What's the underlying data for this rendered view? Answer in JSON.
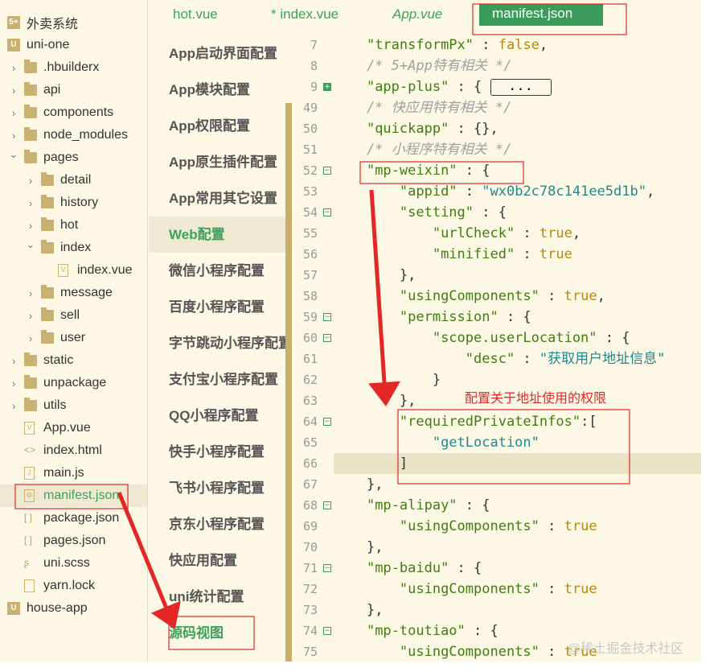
{
  "sidebar": {
    "items": [
      {
        "label": "外卖系统",
        "icon": "hbuilder-project-icon",
        "level": 0,
        "kind": "project5"
      },
      {
        "label": "uni-one",
        "icon": "uni-project-icon",
        "level": 0,
        "kind": "project"
      },
      {
        "label": ".hbuilderx",
        "icon": "folder-icon",
        "level": 1,
        "kind": "folder",
        "state": "collapsed"
      },
      {
        "label": "api",
        "icon": "folder-icon",
        "level": 1,
        "kind": "folder",
        "state": "collapsed"
      },
      {
        "label": "components",
        "icon": "folder-icon",
        "level": 1,
        "kind": "folder",
        "state": "collapsed"
      },
      {
        "label": "node_modules",
        "icon": "folder-icon",
        "level": 1,
        "kind": "folder",
        "state": "collapsed"
      },
      {
        "label": "pages",
        "icon": "folder-open-icon",
        "level": 1,
        "kind": "folder",
        "state": "expanded"
      },
      {
        "label": "detail",
        "icon": "folder-icon",
        "level": 2,
        "kind": "folder",
        "state": "collapsed"
      },
      {
        "label": "history",
        "icon": "folder-icon",
        "level": 2,
        "kind": "folder",
        "state": "collapsed"
      },
      {
        "label": "hot",
        "icon": "folder-icon",
        "level": 2,
        "kind": "folder",
        "state": "collapsed"
      },
      {
        "label": "index",
        "icon": "folder-open-icon",
        "level": 2,
        "kind": "folder",
        "state": "expanded"
      },
      {
        "label": "index.vue",
        "icon": "vue-file-icon",
        "level": 3,
        "kind": "file",
        "glyph": "V"
      },
      {
        "label": "message",
        "icon": "folder-icon",
        "level": 2,
        "kind": "folder",
        "state": "collapsed"
      },
      {
        "label": "sell",
        "icon": "folder-icon",
        "level": 2,
        "kind": "folder",
        "state": "collapsed"
      },
      {
        "label": "user",
        "icon": "folder-icon",
        "level": 2,
        "kind": "folder",
        "state": "collapsed"
      },
      {
        "label": "static",
        "icon": "folder-icon",
        "level": 1,
        "kind": "folder",
        "state": "collapsed"
      },
      {
        "label": "unpackage",
        "icon": "folder-icon",
        "level": 1,
        "kind": "folder",
        "state": "collapsed"
      },
      {
        "label": "utils",
        "icon": "folder-icon",
        "level": 1,
        "kind": "folder",
        "state": "collapsed"
      },
      {
        "label": "App.vue",
        "icon": "vue-file-icon",
        "level": 1,
        "kind": "file",
        "glyph": "V"
      },
      {
        "label": "index.html",
        "icon": "html-file-icon",
        "level": 1,
        "kind": "text",
        "glyph": "<>"
      },
      {
        "label": "main.js",
        "icon": "js-file-icon",
        "level": 1,
        "kind": "file",
        "glyph": "J"
      },
      {
        "label": "manifest.json",
        "icon": "manifest-file-icon",
        "level": 1,
        "kind": "file",
        "glyph": "⚙",
        "selected": true
      },
      {
        "label": "package.json",
        "icon": "json-file-icon",
        "level": 1,
        "kind": "text",
        "glyph": "[ ]"
      },
      {
        "label": "pages.json",
        "icon": "json-file-icon",
        "level": 1,
        "kind": "text",
        "glyph": "[ ]"
      },
      {
        "label": "uni.scss",
        "icon": "scss-file-icon",
        "level": 1,
        "kind": "text",
        "glyph": "ʂ"
      },
      {
        "label": "yarn.lock",
        "icon": "file-icon",
        "level": 1,
        "kind": "file",
        "glyph": ""
      },
      {
        "label": "house-app",
        "icon": "uni-project-icon",
        "level": 0,
        "kind": "project"
      }
    ]
  },
  "tabs": [
    {
      "label": "hot.vue"
    },
    {
      "label": "* index.vue"
    },
    {
      "label": "App.vue",
      "italic": true
    },
    {
      "label": "manifest.json",
      "active": true
    }
  ],
  "settings": {
    "items": [
      {
        "label": "App启动界面配置"
      },
      {
        "label": "App模块配置"
      },
      {
        "label": "App权限配置"
      },
      {
        "label": "App原生插件配置"
      },
      {
        "label": "App常用其它设置"
      },
      {
        "label": "Web配置",
        "selected": true
      },
      {
        "label": "微信小程序配置"
      },
      {
        "label": "百度小程序配置"
      },
      {
        "label": "字节跳动小程序配置"
      },
      {
        "label": "支付宝小程序配置"
      },
      {
        "label": "QQ小程序配置"
      },
      {
        "label": "快手小程序配置"
      },
      {
        "label": "飞书小程序配置"
      },
      {
        "label": "京东小程序配置"
      },
      {
        "label": "快应用配置"
      },
      {
        "label": "uni统计配置"
      },
      {
        "label": "源码视图",
        "highlight": true
      }
    ]
  },
  "editor": {
    "lines": [
      {
        "n": "7",
        "i": 1,
        "t": [
          [
            "k",
            "\"transformPx\""
          ],
          [
            "p",
            " : "
          ],
          [
            "b",
            "false"
          ],
          [
            "p",
            ","
          ]
        ]
      },
      {
        "n": "8",
        "i": 1,
        "t": [
          [
            "c",
            "/* 5+App特有相关 */"
          ]
        ]
      },
      {
        "n": "9",
        "i": 1,
        "fold": "plus",
        "t": [
          [
            "k",
            "\"app-plus\""
          ],
          [
            "p",
            " : { "
          ],
          [
            "coll",
            "..."
          ]
        ]
      },
      {
        "n": "49",
        "i": 1,
        "t": [
          [
            "c",
            "/* 快应用特有相关 */"
          ]
        ]
      },
      {
        "n": "50",
        "i": 1,
        "t": [
          [
            "k",
            "\"quickapp\""
          ],
          [
            "p",
            " : {},"
          ]
        ]
      },
      {
        "n": "51",
        "i": 1,
        "t": [
          [
            "c",
            "/* 小程序特有相关 */"
          ]
        ]
      },
      {
        "n": "52",
        "i": 1,
        "fold": "minus",
        "t": [
          [
            "k",
            "\"mp-weixin\""
          ],
          [
            "p",
            " : {"
          ]
        ]
      },
      {
        "n": "53",
        "i": 2,
        "t": [
          [
            "k",
            "\"appid\""
          ],
          [
            "p",
            " : "
          ],
          [
            "s",
            "\"wx0b2c78c141ee5d1b\""
          ],
          [
            "p",
            ","
          ]
        ]
      },
      {
        "n": "54",
        "i": 2,
        "fold": "minus",
        "t": [
          [
            "k",
            "\"setting\""
          ],
          [
            "p",
            " : {"
          ]
        ]
      },
      {
        "n": "55",
        "i": 3,
        "t": [
          [
            "k",
            "\"urlCheck\""
          ],
          [
            "p",
            " : "
          ],
          [
            "b",
            "true"
          ],
          [
            "p",
            ","
          ]
        ]
      },
      {
        "n": "56",
        "i": 3,
        "t": [
          [
            "k",
            "\"minified\""
          ],
          [
            "p",
            " : "
          ],
          [
            "b",
            "true"
          ]
        ]
      },
      {
        "n": "57",
        "i": 2,
        "t": [
          [
            "p",
            "},"
          ]
        ]
      },
      {
        "n": "58",
        "i": 2,
        "t": [
          [
            "k",
            "\"usingComponents\""
          ],
          [
            "p",
            " : "
          ],
          [
            "b",
            "true"
          ],
          [
            "p",
            ","
          ]
        ]
      },
      {
        "n": "59",
        "i": 2,
        "fold": "minus",
        "t": [
          [
            "k",
            "\"permission\""
          ],
          [
            "p",
            " : {"
          ]
        ]
      },
      {
        "n": "60",
        "i": 3,
        "fold": "minus",
        "t": [
          [
            "k",
            "\"scope.userLocation\""
          ],
          [
            "p",
            " : {"
          ]
        ]
      },
      {
        "n": "61",
        "i": 4,
        "t": [
          [
            "k",
            "\"desc\""
          ],
          [
            "p",
            " : "
          ],
          [
            "s",
            "\"获取用户地址信息\""
          ]
        ]
      },
      {
        "n": "62",
        "i": 3,
        "t": [
          [
            "p",
            "}"
          ]
        ]
      },
      {
        "n": "63",
        "i": 2,
        "t": [
          [
            "p",
            "},"
          ]
        ]
      },
      {
        "n": "64",
        "i": 2,
        "fold": "minus",
        "t": [
          [
            "k",
            "\"requiredPrivateInfos\""
          ],
          [
            "p",
            ":["
          ]
        ]
      },
      {
        "n": "65",
        "i": 3,
        "t": [
          [
            "s",
            "\"getLocation\""
          ]
        ]
      },
      {
        "n": "66",
        "i": 2,
        "current": true,
        "t": [
          [
            "p",
            "]"
          ]
        ]
      },
      {
        "n": "67",
        "i": 1,
        "t": [
          [
            "p",
            "},"
          ]
        ]
      },
      {
        "n": "68",
        "i": 1,
        "fold": "minus",
        "t": [
          [
            "k",
            "\"mp-alipay\""
          ],
          [
            "p",
            " : {"
          ]
        ]
      },
      {
        "n": "69",
        "i": 2,
        "t": [
          [
            "k",
            "\"usingComponents\""
          ],
          [
            "p",
            " : "
          ],
          [
            "b",
            "true"
          ]
        ]
      },
      {
        "n": "70",
        "i": 1,
        "t": [
          [
            "p",
            "},"
          ]
        ]
      },
      {
        "n": "71",
        "i": 1,
        "fold": "minus",
        "t": [
          [
            "k",
            "\"mp-baidu\""
          ],
          [
            "p",
            " : {"
          ]
        ]
      },
      {
        "n": "72",
        "i": 2,
        "t": [
          [
            "k",
            "\"usingComponents\""
          ],
          [
            "p",
            " : "
          ],
          [
            "b",
            "true"
          ]
        ]
      },
      {
        "n": "73",
        "i": 1,
        "t": [
          [
            "p",
            "},"
          ]
        ]
      },
      {
        "n": "74",
        "i": 1,
        "fold": "minus",
        "t": [
          [
            "k",
            "\"mp-toutiao\""
          ],
          [
            "p",
            " : {"
          ]
        ]
      },
      {
        "n": "75",
        "i": 2,
        "t": [
          [
            "k",
            "\"usingComponents\""
          ],
          [
            "p",
            " : "
          ],
          [
            "b",
            "true"
          ]
        ]
      }
    ]
  },
  "annotation": {
    "note": "配置关于地址使用的权限",
    "color": "#e32626"
  },
  "watermark": "@稀土掘金技术社区",
  "colors": {
    "background": "#fdf8e6",
    "accent": "#3a9b5a",
    "key": "#3f7d12",
    "string": "#1f8a8a",
    "boolean": "#b8870b",
    "comment": "#a0a0a0"
  }
}
